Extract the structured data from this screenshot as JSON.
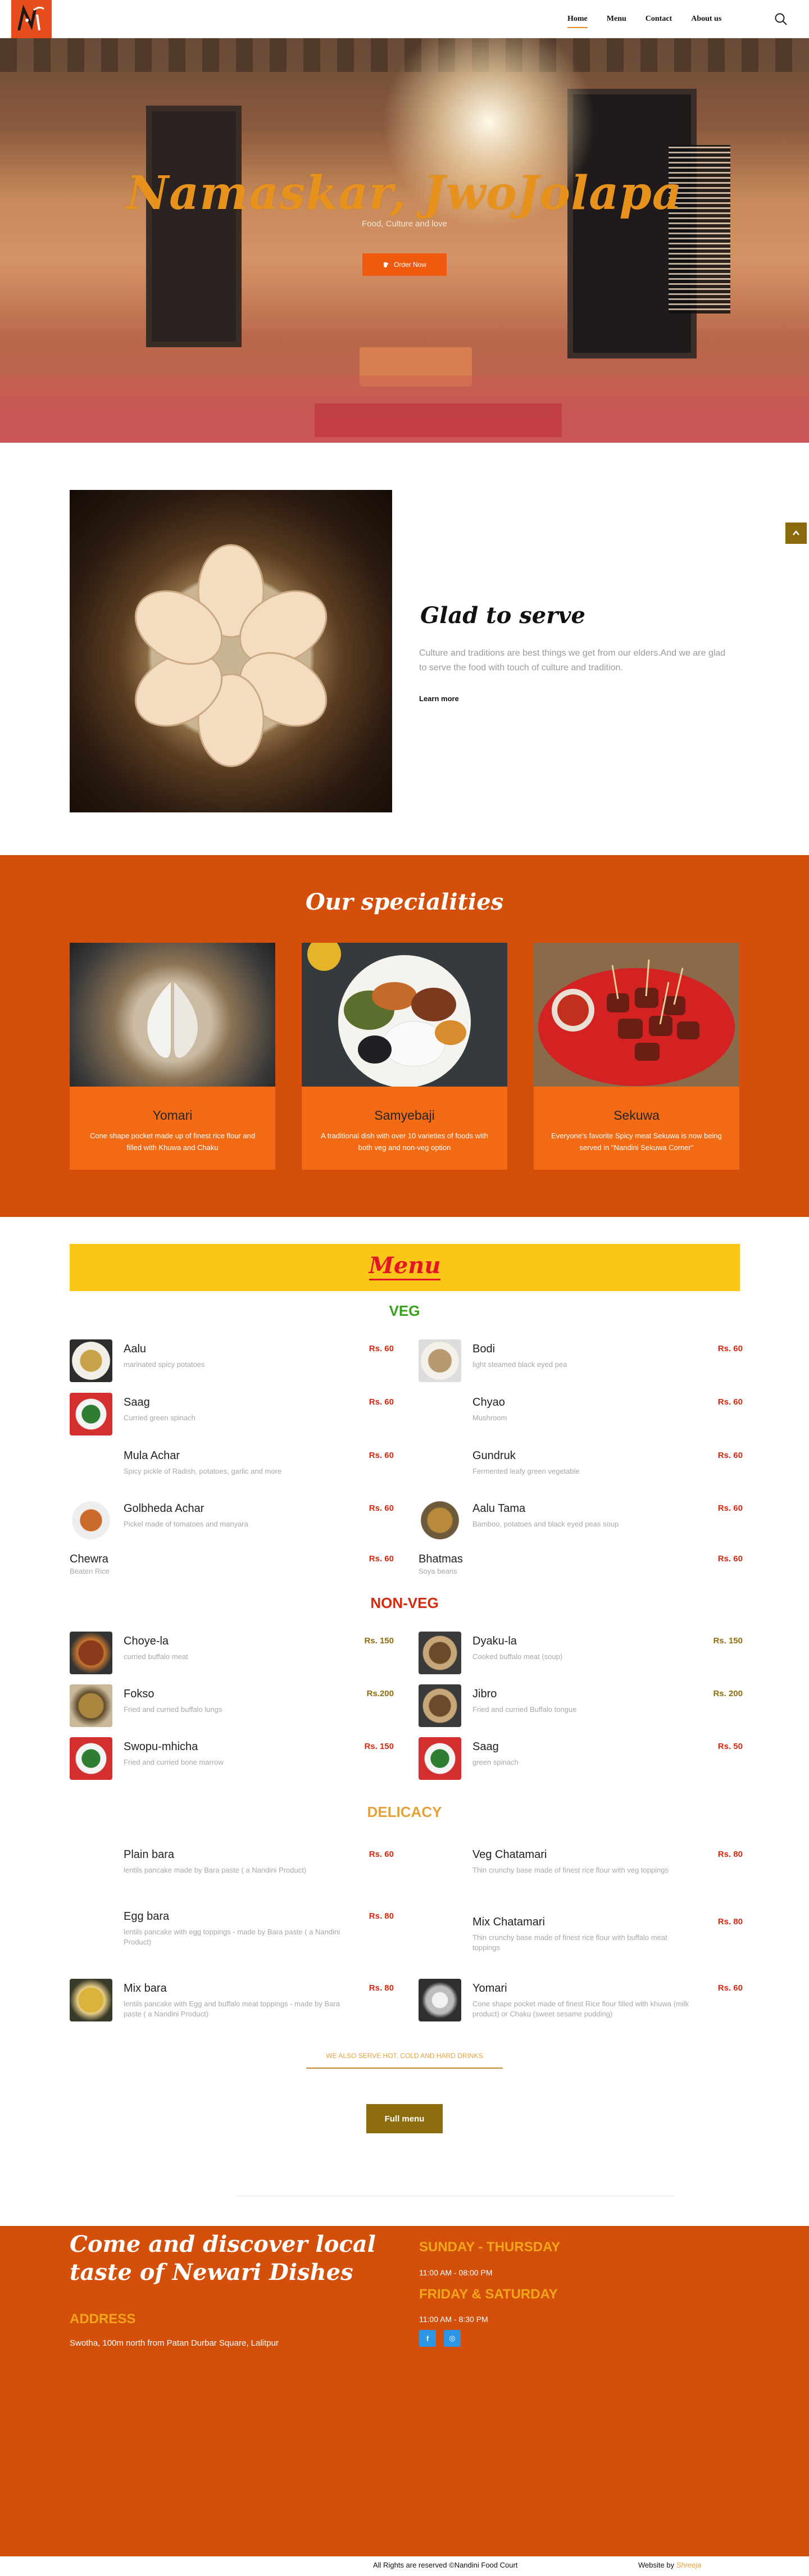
{
  "nav": {
    "items": [
      "Home",
      "Menu",
      "Contact",
      "About us"
    ],
    "active": "Home"
  },
  "hero": {
    "title": "Namaskar, JwoJolapa",
    "subtitle": "Food, Culture and love",
    "cta": "Order Now"
  },
  "about": {
    "title": "Glad to serve",
    "text": "Culture and traditions are best things we get from our elders.And we are glad to serve the food with touch of culture and tradition.",
    "link": "Learn more"
  },
  "specialities": {
    "title": "Our specialities",
    "cards": [
      {
        "name": "Yomari",
        "desc": "Cone shape pocket made up of finest rice flour and filled with Khuwa and Chaku"
      },
      {
        "name": "Samyebaji",
        "desc": "A traditional dish with over 10 varieties of foods with both veg and non-veg option"
      },
      {
        "name": "Sekuwa",
        "desc": "Everyone's favorite Spicy meat Sekuwa is now being served in \"Nandini Sekuwa Corner\""
      }
    ]
  },
  "menu": {
    "title": "Menu",
    "veg_title": "VEG",
    "nonveg_title": "NON-VEG",
    "delicacy_title": "DELICACY",
    "veg": [
      {
        "name": "Aalu",
        "desc": "marinated spicy potatoes",
        "price": "Rs. 60"
      },
      {
        "name": "Bodi",
        "desc": "light steamed black eyed pea",
        "price": "Rs. 60"
      },
      {
        "name": "Saag",
        "desc": "Curried green spinach",
        "price": "Rs. 60"
      },
      {
        "name": "Chyao",
        "desc": "Mushroom",
        "price": "Rs. 60"
      },
      {
        "name": "Mula Achar",
        "desc": "Spicy pickle of Radish, potatoes, garlic and more",
        "price": "Rs. 60"
      },
      {
        "name": "Gundruk",
        "desc": "Fermented leafy green vegetable",
        "price": "Rs. 60"
      },
      {
        "name": "Golbheda Achar",
        "desc": "Pickel made of tomatoes and manyara",
        "price": "Rs. 60"
      },
      {
        "name": "Aalu Tama",
        "desc": "Bamboo, potatoes and black eyed peas soup",
        "price": "Rs. 60"
      },
      {
        "name": "Chewra",
        "desc": "Beaten Rice",
        "price": "Rs. 60"
      },
      {
        "name": "Bhatmas",
        "desc": "Soya beans",
        "price": "Rs. 60"
      }
    ],
    "nonveg": [
      {
        "name": "Choye-la",
        "desc": "curried buffalo meat",
        "price": "Rs. 150"
      },
      {
        "name": "Dyaku-la",
        "desc": "Cooked buffalo meat (soup)",
        "price": "Rs. 150"
      },
      {
        "name": "Fokso",
        "desc": "Fried and curried buffalo lungs",
        "price": "Rs.200"
      },
      {
        "name": "Jibro",
        "desc": "Fried and curried Buffalo tongue",
        "price": "Rs. 200"
      },
      {
        "name": "Swopu-mhicha",
        "desc": "Fried and curried bone marrow",
        "price": "Rs. 150"
      },
      {
        "name": "Saag",
        "desc": "green spinach",
        "price": "Rs. 50"
      }
    ],
    "delicacy": [
      {
        "name": "Plain bara",
        "desc": "lentils pancake made by Bara paste ( a Nandini Product)",
        "price": "Rs. 60"
      },
      {
        "name": "Veg Chatamari",
        "desc": "Thin crunchy base made of finest rice flour with veg toppings",
        "price": "Rs. 80"
      },
      {
        "name": "Egg bara",
        "desc": "lentils pancake with egg toppings - made by Bara paste ( a Nandini Product)",
        "price": "Rs. 80"
      },
      {
        "name": "Mix Chatamari",
        "desc": "Thin crunchy base made of finest rice flour with buffalo meat toppings",
        "price": "Rs. 80"
      },
      {
        "name": "Mix bara",
        "desc": "lentils pancake with Egg and buffalo meat toppings - made by Bara paste ( a Nandini Product)",
        "price": "Rs. 80"
      },
      {
        "name": "Yomari",
        "desc": "Cone shape pocket made of finest Rice flour filled with khuwa (milk product) or Chaku (sweet sesame pudding)",
        "price": "Rs. 60"
      }
    ],
    "also": "WE ALSO SERVE HOT, COLD AND HARD DRINKS",
    "full_btn": "Full menu"
  },
  "footer": {
    "title": "Come and discover local taste of Newari Dishes",
    "address_title": "ADDRESS",
    "address": "Swotha, 100m north from Patan Durbar Square, Lalitpur",
    "weekdays_title": "SUNDAY - THURSDAY",
    "weekdays_hours": "11:00 AM - 08:00 PM",
    "weekend_title": "FRIDAY & SATURDAY",
    "weekend_hours": "11:00 AM - 8:30 PM",
    "social": [
      "f",
      "◎"
    ],
    "copyright": "All Rights are reserved ©Nandini Food Court",
    "credit_prefix": "Website by ",
    "credit_name": "Shreeja"
  },
  "colors": {
    "accent": "#d4500a",
    "yellow": "#fac718",
    "price": "#d7280f",
    "gold": "#8c6c0c"
  }
}
